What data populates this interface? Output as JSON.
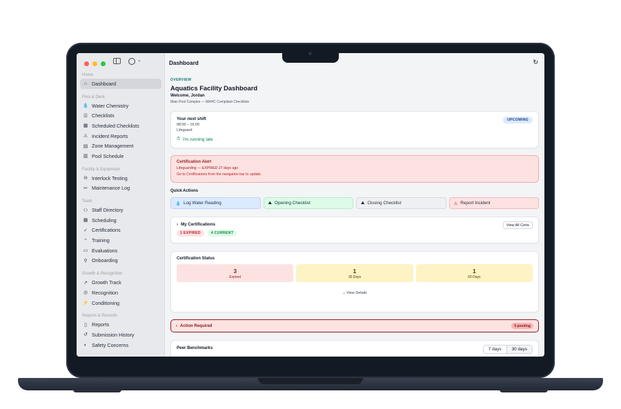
{
  "sidebar": {
    "dashboard": "Dashboard",
    "sections": [
      {
        "title": "Pool & Deck",
        "items": [
          "Water Chemistry",
          "Checklists",
          "Scheduled Checklists",
          "Incident Reports",
          "Zone Management",
          "Pool Schedule"
        ]
      },
      {
        "title": "Facility & Equipment",
        "items": [
          "Interlock Testing",
          "Maintenance Log"
        ]
      },
      {
        "title": "Team",
        "items": [
          "Staff Directory",
          "Scheduling",
          "Certifications",
          "Training",
          "Evaluations",
          "Onboarding"
        ]
      },
      {
        "title": "Growth & Recognition",
        "items": [
          "Growth Track",
          "Recognition",
          "Conditioning"
        ]
      },
      {
        "title": "Reports & Records",
        "items": [
          "Reports",
          "Submission History",
          "Safety Concerns"
        ]
      }
    ]
  },
  "header": {
    "title": "Dashboard"
  },
  "main": {
    "overview": "OVERVIEW",
    "title": "Aquatics Facility Dashboard",
    "welcome": "Welcome, Jordan",
    "subtitle": "Main Pool Complex — MAHC Compliant Checklists",
    "shift": {
      "title": "Your next shift",
      "time": "08:00 – 16:00",
      "role": "Lifeguard",
      "late": "I'm running late",
      "badge": "UPCOMING"
    },
    "alert": {
      "title": "Certification Alert",
      "detail": "Lifeguarding — EXPIRED 27 days ago",
      "hint": "Go to Certifications from the navigation bar to update."
    },
    "quick_actions": {
      "title": "Quick Actions",
      "buttons": [
        "Log Water Reading",
        "Opening Checklist",
        "Closing Checklist",
        "Report Incident"
      ]
    },
    "my_certs": {
      "title": "My Certifications",
      "view_all": "View All Certs",
      "expired": "1 EXPIRED",
      "current": "4 CURRENT"
    },
    "cert_status": {
      "title": "Certification Status",
      "tiles": [
        {
          "value": "3",
          "label": "Expired"
        },
        {
          "value": "1",
          "label": "30 Days"
        },
        {
          "value": "1",
          "label": "60 Days"
        }
      ],
      "details": "View Details"
    },
    "action_required": {
      "title": "Action Required",
      "badge": "5 pending"
    },
    "benchmarks": {
      "title": "Peer Benchmarks",
      "seg": [
        "7 days",
        "30 days"
      ]
    }
  }
}
